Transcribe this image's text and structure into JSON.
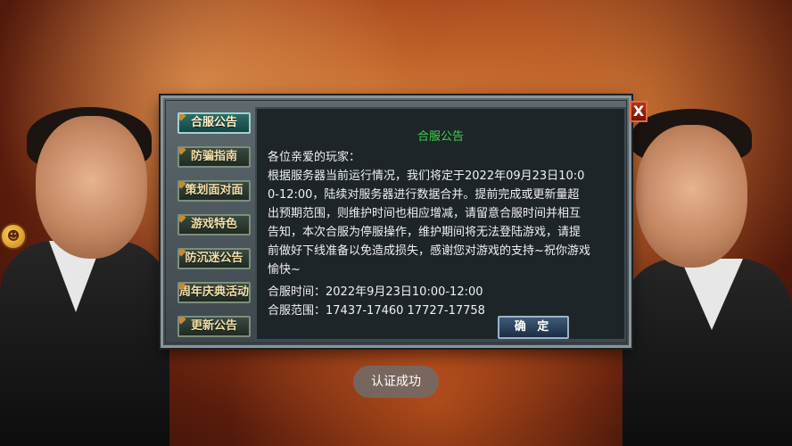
{
  "dialog": {
    "title": "合服公告",
    "tabs": [
      {
        "label": "合服公告",
        "active": true
      },
      {
        "label": "防骗指南",
        "active": false
      },
      {
        "label": "策划面对面",
        "active": false
      },
      {
        "label": "游戏特色",
        "active": false
      },
      {
        "label": "防沉迷公告",
        "active": false
      },
      {
        "label": "周年庆典活动",
        "active": false
      },
      {
        "label": "更新公告",
        "active": false
      }
    ],
    "body": {
      "greeting": "各位亲爱的玩家：",
      "paragraph": "根据服务器当前运行情况，我们将定于2022年09月23日10:00-12:00，陆续对服务器进行数据合并。提前完成或更新量超出预期范围，则维护时间也相应增减，请留意合服时间并相互告知，本次合服为停服操作，维护期间将无法登陆游戏，请提前做好下线准备以免造成损失，感谢您对游戏的支持~祝你游戏愉快~",
      "merge_time": "合服时间：2022年9月23日10:00-12:00",
      "merge_range": "合服范围：17437-17460 17727-17758"
    },
    "confirm_label": "确 定",
    "close_label": "X"
  },
  "toast": {
    "text": "认证成功"
  },
  "side_icon": {
    "name": "gift-icon",
    "glyph": "☻"
  }
}
